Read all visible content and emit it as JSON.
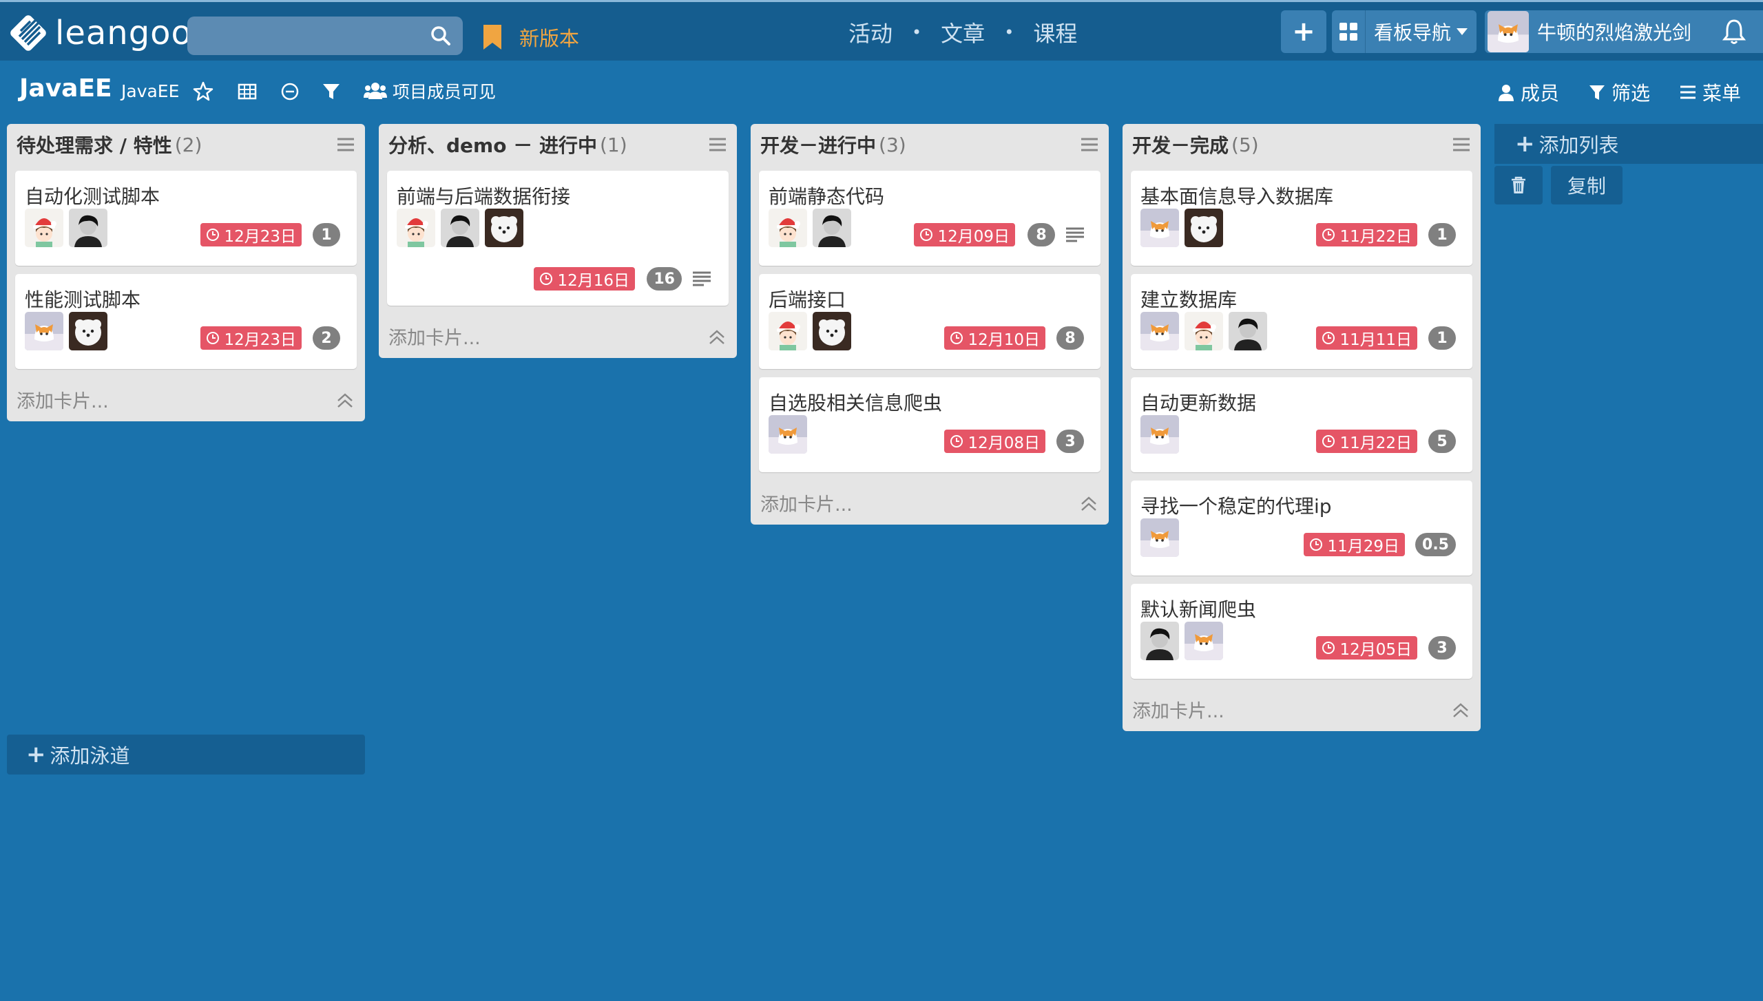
{
  "header": {
    "logo_text": "leangoo",
    "search_placeholder": "",
    "new_version": "新版本",
    "nav": [
      "活动",
      "文章",
      "课程"
    ],
    "nav_sep": "•",
    "add_label": "+",
    "board_nav": "看板导航",
    "user_name": "牛顿的烈焰激光剑"
  },
  "board": {
    "title": "JavaEE",
    "subtitle": "JavaEE",
    "visibility": "项目成员可见",
    "members": "成员",
    "filter": "筛选",
    "menu": "菜单"
  },
  "lists": [
    {
      "title": "待处理需求 / 特性",
      "count": "(2)",
      "add_card": "添加卡片...",
      "cards": [
        {
          "title": "自动化测试脚本",
          "avatars": [
            "santa-girl",
            "dark-hair-boy"
          ],
          "due": "12月23日",
          "count": "1"
        },
        {
          "title": "性能测试脚本",
          "avatars": [
            "orange-cat",
            "white-dog"
          ],
          "due": "12月23日",
          "count": "2"
        }
      ]
    },
    {
      "title": "分析、demo － 进行中",
      "count": "(1)",
      "add_card": "添加卡片...",
      "cards": [
        {
          "title": "前端与后端数据衔接",
          "avatars": [
            "santa-girl",
            "dark-hair-boy",
            "white-dog"
          ],
          "due": "12月16日",
          "count": "16",
          "desc": true
        }
      ]
    },
    {
      "title": "开发－进行中",
      "count": "(3)",
      "add_card": "添加卡片...",
      "cards": [
        {
          "title": "前端静态代码",
          "avatars": [
            "santa-girl",
            "dark-hair-boy"
          ],
          "due": "12月09日",
          "count": "8",
          "desc": true
        },
        {
          "title": "后端接口",
          "avatars": [
            "santa-girl",
            "white-dog"
          ],
          "due": "12月10日",
          "count": "8"
        },
        {
          "title": "自选股相关信息爬虫",
          "avatars": [
            "orange-cat"
          ],
          "due": "12月08日",
          "count": "3"
        }
      ]
    },
    {
      "title": "开发－完成",
      "count": "(5)",
      "add_card": "添加卡片...",
      "cards": [
        {
          "title": "基本面信息导入数据库",
          "avatars": [
            "orange-cat",
            "white-dog"
          ],
          "due": "11月22日",
          "count": "1"
        },
        {
          "title": "建立数据库",
          "avatars": [
            "orange-cat",
            "santa-girl",
            "dark-hair-boy"
          ],
          "due": "11月11日",
          "count": "1"
        },
        {
          "title": "自动更新数据",
          "avatars": [
            "orange-cat"
          ],
          "due": "11月22日",
          "count": "5"
        },
        {
          "title": "寻找一个稳定的代理ip",
          "avatars": [
            "orange-cat"
          ],
          "due": "11月29日",
          "count": "0.5"
        },
        {
          "title": "默认新闻爬虫",
          "avatars": [
            "dark-hair-boy",
            "orange-cat"
          ],
          "due": "12月05日",
          "count": "3"
        }
      ]
    }
  ],
  "add_list": "添加列表",
  "copy": "复制",
  "add_lane": "添加泳道",
  "colors": {
    "background": "#1a72ac",
    "topbar": "#155d8f",
    "due_badge": "#e55566",
    "count_badge": "#808080",
    "new_version": "#f0a541"
  }
}
